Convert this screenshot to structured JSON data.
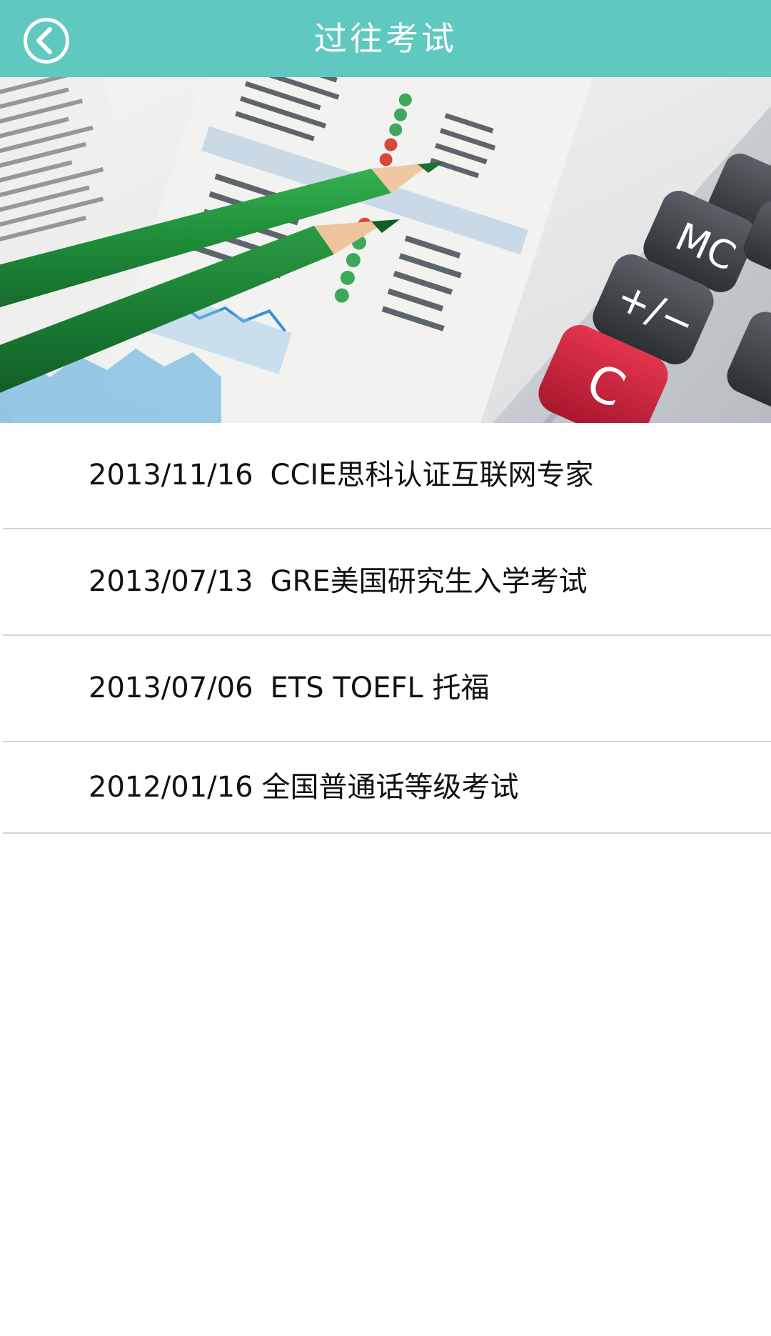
{
  "header": {
    "title": "过往考试",
    "back_icon": "chevron-left-circle-icon",
    "background_color": "#5fc9c0"
  },
  "banner": {
    "image": "newspaper-stock-table-with-green-pencils-and-calculator"
  },
  "exams": [
    {
      "date": "2013/11/16",
      "name": "CCIE思科认证互联网专家"
    },
    {
      "date": "2013/07/13",
      "name": "GRE美国研究生入学考试"
    },
    {
      "date": "2013/07/06",
      "name": "ETS TOEFL 托福"
    },
    {
      "date": "2012/01/16",
      "name": "全国普通话等级考试"
    }
  ]
}
